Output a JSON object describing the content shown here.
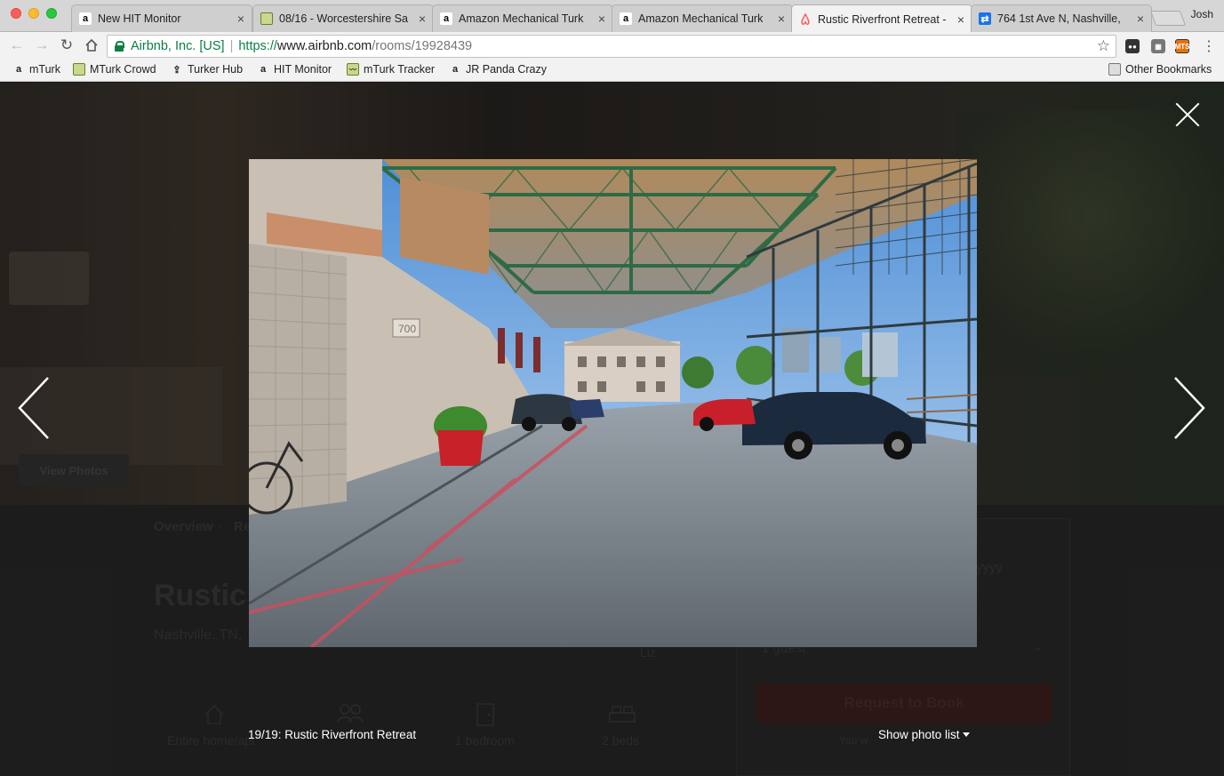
{
  "browser": {
    "profile_name": "Josh",
    "tabs": [
      {
        "title": "New HIT Monitor",
        "icon": "amazon-icon",
        "active": false
      },
      {
        "title": "08/16 - Worcestershire Sa",
        "icon": "folder-icon",
        "active": false
      },
      {
        "title": "Amazon Mechanical Turk",
        "icon": "amazon-icon",
        "active": false
      },
      {
        "title": "Amazon Mechanical Turk",
        "icon": "amazon-icon",
        "active": false
      },
      {
        "title": "Rustic Riverfront Retreat -",
        "icon": "airbnb-icon",
        "active": true
      },
      {
        "title": "764 1st Ave N, Nashville,",
        "icon": "map-icon",
        "active": false
      }
    ],
    "address_bar": {
      "site_identity": "Airbnb, Inc. [US]",
      "separator": "|",
      "scheme": "https://",
      "host": "www.airbnb.com",
      "path": "/rooms/19928439"
    },
    "bookmarks": [
      {
        "label": "mTurk",
        "icon": "amazon-icon"
      },
      {
        "label": "MTurk Crowd",
        "icon": "folder-icon"
      },
      {
        "label": "Turker Hub",
        "icon": "upload-icon"
      },
      {
        "label": "HIT Monitor",
        "icon": "amazon-icon"
      },
      {
        "label": "mTurk Tracker",
        "icon": "chart-icon"
      },
      {
        "label": "JR Panda Crazy",
        "icon": "amazon-icon"
      }
    ],
    "other_bookmarks": "Other Bookmarks"
  },
  "background_page": {
    "view_photos": "View Photos",
    "overview": "Overview",
    "tab_fragment": "Re",
    "title_fragment": "Rustic",
    "location_fragment": "Nashville, TN,",
    "host_fragment": "Liz",
    "date_fragment": "yyyy",
    "guests_fragment": "1 guest",
    "request_to_book": "Request to Book",
    "you_fragment": "You w",
    "amenities": [
      {
        "label": "Entire home/apt",
        "icon": "home-icon"
      },
      {
        "label": "",
        "icon": "guests-icon"
      },
      {
        "label": "1 bedroom",
        "icon": "door-icon"
      },
      {
        "label": "2 beds",
        "icon": "bed-icon"
      }
    ]
  },
  "lightbox": {
    "caption": "19/19: Rustic Riverfront Retreat",
    "show_photo_list": "Show photo list",
    "photo_alt": "Covered parking garage with green steel trusses",
    "building_number": "700"
  },
  "colors": {
    "airbnb_red": "#ff5a5f",
    "secure_green": "#0b8043",
    "overlay": "rgba(0,0,0,0.38)"
  }
}
